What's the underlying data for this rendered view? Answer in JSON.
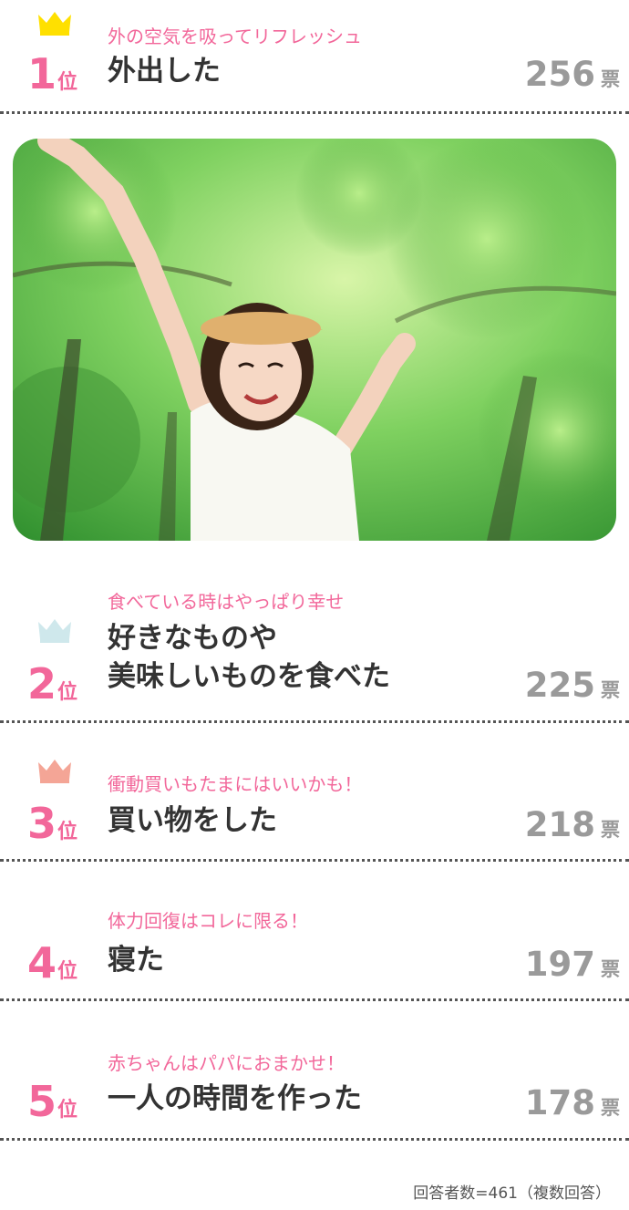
{
  "colors": {
    "accent_pink": "#f2679a",
    "gold": "#ffe000",
    "silver": "#cfe8ec",
    "bronze": "#f4a596",
    "vote_gray": "#9a9a9a"
  },
  "rankings": [
    {
      "rank": "1",
      "suffix": "位",
      "tagline": "外の空気を吸ってリフレッシュ",
      "answer_lines": [
        "外出した"
      ],
      "votes": "256",
      "unit": "票",
      "crown": "gold-crown-icon"
    },
    {
      "rank": "2",
      "suffix": "位",
      "tagline": "食べている時はやっぱり幸せ",
      "answer_lines": [
        "好きなものや",
        "美味しいものを食べた"
      ],
      "votes": "225",
      "unit": "票",
      "crown": "silver-crown-icon"
    },
    {
      "rank": "3",
      "suffix": "位",
      "tagline": "衝動買いもたまにはいいかも！",
      "answer_lines": [
        "買い物をした"
      ],
      "votes": "218",
      "unit": "票",
      "crown": "bronze-crown-icon"
    },
    {
      "rank": "4",
      "suffix": "位",
      "tagline": "体力回復はコレに限る！",
      "answer_lines": [
        "寝た"
      ],
      "votes": "197",
      "unit": "票"
    },
    {
      "rank": "5",
      "suffix": "位",
      "tagline": "赤ちゃんはパパにおまかせ！",
      "answer_lines": [
        "一人の時間を作った"
      ],
      "votes": "178",
      "unit": "票"
    }
  ],
  "footer": {
    "note": "回答者数=461（複数回答）"
  }
}
